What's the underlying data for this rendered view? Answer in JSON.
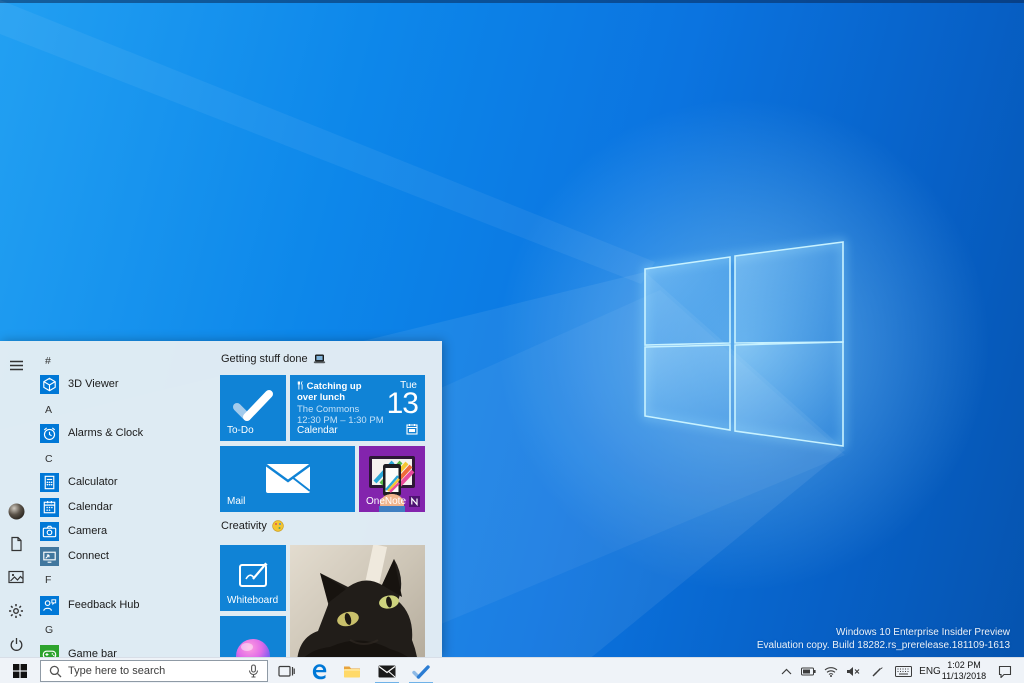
{
  "wallpaper": {
    "line1": "Windows 10 Enterprise Insider Preview",
    "line2": "Evaluation copy. Build 18282.rs_prerelease.181109-1613"
  },
  "colors": {
    "accent_blue": "#0078d7",
    "tile_blue": "#1083d6",
    "onenote_purple": "#8324ad",
    "gamebar_green": "#2da32d",
    "menu_background": "#e4edf3",
    "taskbar_background": "#eff3f8"
  },
  "start_menu": {
    "rail_icons": [
      "hamburger-menu",
      "user-avatar",
      "documents",
      "pictures",
      "settings",
      "power"
    ],
    "app_list": [
      {
        "type": "header",
        "label": "#"
      },
      {
        "type": "app",
        "label": "3D Viewer",
        "icon": "viewer3d",
        "color": "#0078d7",
        "slug": "3d-viewer"
      },
      {
        "type": "header",
        "label": "A"
      },
      {
        "type": "app",
        "label": "Alarms & Clock",
        "icon": "alarms",
        "color": "#0078d7",
        "slug": "alarms-clock"
      },
      {
        "type": "header",
        "label": "C"
      },
      {
        "type": "app",
        "label": "Calculator",
        "icon": "calculator",
        "color": "#0078d7",
        "slug": "calculator"
      },
      {
        "type": "app",
        "label": "Calendar",
        "icon": "calendar",
        "color": "#0078d7",
        "slug": "calendar"
      },
      {
        "type": "app",
        "label": "Camera",
        "icon": "camera",
        "color": "#0078d7",
        "slug": "camera"
      },
      {
        "type": "app",
        "label": "Connect",
        "icon": "connect",
        "color": "#41779e",
        "slug": "connect"
      },
      {
        "type": "header",
        "label": "F"
      },
      {
        "type": "app",
        "label": "Feedback Hub",
        "icon": "feedback",
        "color": "#0078d7",
        "slug": "feedback-hub"
      },
      {
        "type": "header",
        "label": "G"
      },
      {
        "type": "app",
        "label": "Game bar",
        "icon": "gamebar",
        "color": "#2da32d",
        "slug": "game-bar"
      }
    ],
    "groups": [
      {
        "title": "Getting stuff done",
        "emoji": "laptop-emoji"
      },
      {
        "title": "Creativity",
        "emoji": "palette-emoji"
      }
    ],
    "tiles": {
      "todo": {
        "label": "To-Do"
      },
      "calendar": {
        "label": "Calendar",
        "event_title": "Catching up over lunch",
        "event_location": "The Commons",
        "event_time": "12:30 PM – 1:30 PM",
        "day_abbr": "Tue",
        "day_num": "13"
      },
      "mail": {
        "label": "Mail"
      },
      "onenote": {
        "label": "OneNote"
      },
      "whiteboard": {
        "label": "Whiteboard"
      },
      "photos_cat": {
        "label": ""
      },
      "paint3d": {
        "label": ""
      }
    }
  },
  "taskbar": {
    "search_placeholder": "Type here to search",
    "app_icons": [
      "start",
      "cortana-mic",
      "task-view",
      "edge",
      "file-explorer",
      "mail",
      "to-do"
    ],
    "running_apps": [
      "mail",
      "to-do"
    ],
    "tray_icons": [
      "hidden-icons-chevron",
      "battery",
      "wifi",
      "volume-muted",
      "windows-ink",
      "touch-keyboard",
      "action-center"
    ],
    "language": "ENG",
    "time": "1:02 PM",
    "date": "11/13/2018"
  }
}
